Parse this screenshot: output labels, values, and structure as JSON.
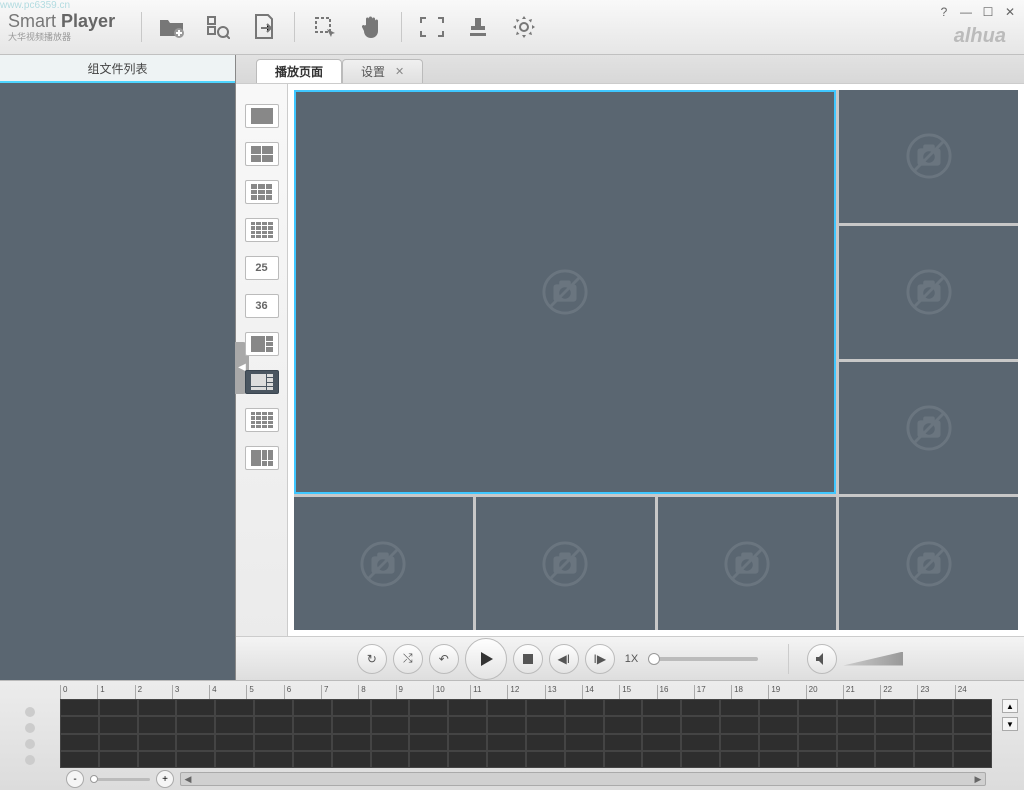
{
  "app": {
    "title_prefix": "Smart",
    "title_suffix": "Player",
    "subtitle": "大华视频播放器",
    "watermark_site": "www.pc6359.cn",
    "brand": "alhua"
  },
  "window_controls": {
    "help": "?",
    "min": "—",
    "max": "☐",
    "close": "✕"
  },
  "toolbar_icons": [
    "add-folder",
    "search",
    "export",
    "select-region",
    "pan",
    "fullscreen",
    "watermark",
    "settings"
  ],
  "sidebar": {
    "tab_label": "组文件列表"
  },
  "tabs": [
    {
      "label": "播放页面",
      "active": true,
      "closable": false
    },
    {
      "label": "设置",
      "active": false,
      "closable": true
    }
  ],
  "layout_options": [
    {
      "id": "layout-1",
      "type": "grid",
      "cols": 1,
      "rows": 1,
      "selected": false
    },
    {
      "id": "layout-4",
      "type": "grid",
      "cols": 2,
      "rows": 2,
      "selected": false
    },
    {
      "id": "layout-9",
      "type": "grid",
      "cols": 3,
      "rows": 3,
      "selected": false
    },
    {
      "id": "layout-16",
      "type": "grid",
      "cols": 4,
      "rows": 4,
      "selected": false
    },
    {
      "id": "layout-25",
      "type": "text",
      "text": "25",
      "selected": false
    },
    {
      "id": "layout-36",
      "type": "text",
      "text": "36",
      "selected": false
    },
    {
      "id": "layout-6",
      "type": "preset-6",
      "selected": false
    },
    {
      "id": "layout-8",
      "type": "preset-8",
      "selected": true
    },
    {
      "id": "layout-13",
      "type": "preset-13",
      "selected": false
    },
    {
      "id": "layout-custom",
      "type": "preset-custom",
      "selected": false
    }
  ],
  "video_grid": {
    "layout": "1-big-7-small",
    "cells": 8
  },
  "playback": {
    "buttons": [
      "loop",
      "shuffle",
      "rewind",
      "play",
      "stop",
      "step-back",
      "step-forward"
    ],
    "speed": "1X",
    "volume_icon": "speaker-icon"
  },
  "timeline": {
    "hours": [
      "0",
      "1",
      "2",
      "3",
      "4",
      "5",
      "6",
      "7",
      "8",
      "9",
      "10",
      "11",
      "12",
      "13",
      "14",
      "15",
      "16",
      "17",
      "18",
      "19",
      "20",
      "21",
      "22",
      "23",
      "24"
    ],
    "track_rows": 4
  }
}
